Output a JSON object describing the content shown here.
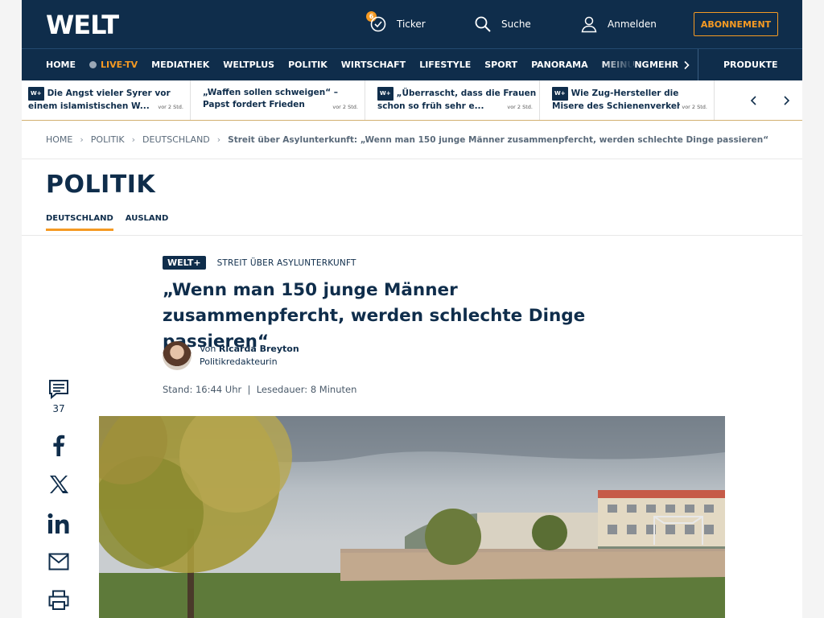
{
  "header": {
    "logo": "WELT",
    "ticker_label": "Ticker",
    "ticker_count": "6",
    "search_label": "Suche",
    "login_label": "Anmelden",
    "subscription_label": "ABONNEMENT"
  },
  "nav": {
    "items": [
      {
        "label": "HOME"
      },
      {
        "label": "LIVE-TV"
      },
      {
        "label": "MEDIATHEK"
      },
      {
        "label": "WELTPLUS"
      },
      {
        "label": "POLITIK"
      },
      {
        "label": "WIRTSCHAFT"
      },
      {
        "label": "LIFESTYLE"
      },
      {
        "label": "SPORT"
      },
      {
        "label": "PANORAMA"
      },
      {
        "label": "MEINUNG"
      }
    ],
    "more_label": "MEHR",
    "products_label": "PRODUKTE"
  },
  "teasers": [
    {
      "title": "Die Angst vieler Syrer vor einem islamistischen W...",
      "time": "vor 2 Std.",
      "weltplus": "W+"
    },
    {
      "title": "„Waffen sollen schweigen“ – Papst fordert Frieden",
      "time": "vor 2 Std."
    },
    {
      "title": "„Überrascht, dass die Frauen schon so früh sehr e...",
      "time": "vor 2 Std.",
      "weltplus": "W+"
    },
    {
      "title": "Wie Zug-Hersteller die Misere des Schienenverkehr...",
      "time": "vor 2 Std.",
      "weltplus": "W+"
    }
  ],
  "breadcrumb": {
    "items": [
      "HOME",
      "POLITIK",
      "DEUTSCHLAND"
    ],
    "current": "Streit über Asylunterkunft: „Wenn man 150 junge Männer zusammenpfercht, werden schlechte Dinge passieren“"
  },
  "section": {
    "title": "POLITIK",
    "tabs": [
      "DEUTSCHLAND",
      "AUSLAND"
    ]
  },
  "article": {
    "badge": "WELT+",
    "kicker": "STREIT ÜBER ASYLUNTERKUNFT",
    "headline": "„Wenn man 150 junge Männer zusammenpfercht, werden schlechte Dinge passieren“",
    "author_prefix": "Von",
    "author_name": "Ricarda Breyton",
    "author_role": "Politikredakteurin",
    "meta": "Stand: 16:44 Uhr  |  Lesedauer: 8 Minuten",
    "comment_count": "37"
  },
  "colors": {
    "brand_navy": "#0f2d4b",
    "accent_orange": "#f59a23"
  }
}
